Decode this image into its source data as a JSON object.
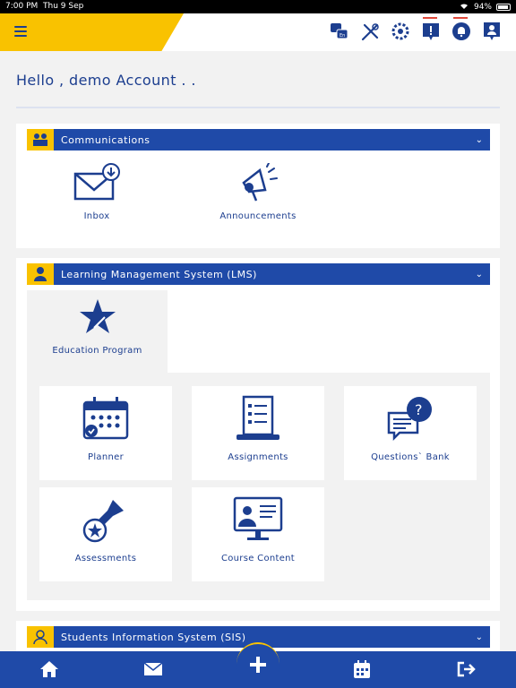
{
  "status_bar": {
    "time": "7:00 PM",
    "date": "Thu 9 Sep",
    "battery": "94%"
  },
  "header": {
    "menu_icon": "hamburger-icon",
    "icons": [
      "translate-icon",
      "tools-icon",
      "settings-icon",
      "alerts-icon",
      "notifications-icon",
      "profile-icon"
    ]
  },
  "greeting": "Hello , demo Account . .",
  "communications": {
    "title": "Communications",
    "items": [
      {
        "label": "Inbox",
        "icon": "inbox-icon"
      },
      {
        "label": "Announcements",
        "icon": "megaphone-icon"
      }
    ]
  },
  "lms": {
    "title": "Learning Management System (LMS)",
    "program_tab": {
      "label": "Education Program",
      "icon": "star-icon"
    },
    "tiles": [
      {
        "label": "Planner",
        "icon": "calendar-icon"
      },
      {
        "label": "Assignments",
        "icon": "assignments-icon"
      },
      {
        "label": "Questions` Bank",
        "icon": "questions-icon"
      },
      {
        "label": "Assessments",
        "icon": "stamp-icon"
      },
      {
        "label": "Course Content",
        "icon": "course-content-icon"
      }
    ]
  },
  "sis": {
    "title": "Students Information System (SIS)"
  },
  "bottom_nav": {
    "items": [
      "home-icon",
      "mail-icon",
      "add-icon",
      "calendar-icon",
      "logout-icon"
    ]
  },
  "colors": {
    "primary": "#1f4aa8",
    "accent": "#f9c200",
    "background": "#f2f2f2"
  }
}
